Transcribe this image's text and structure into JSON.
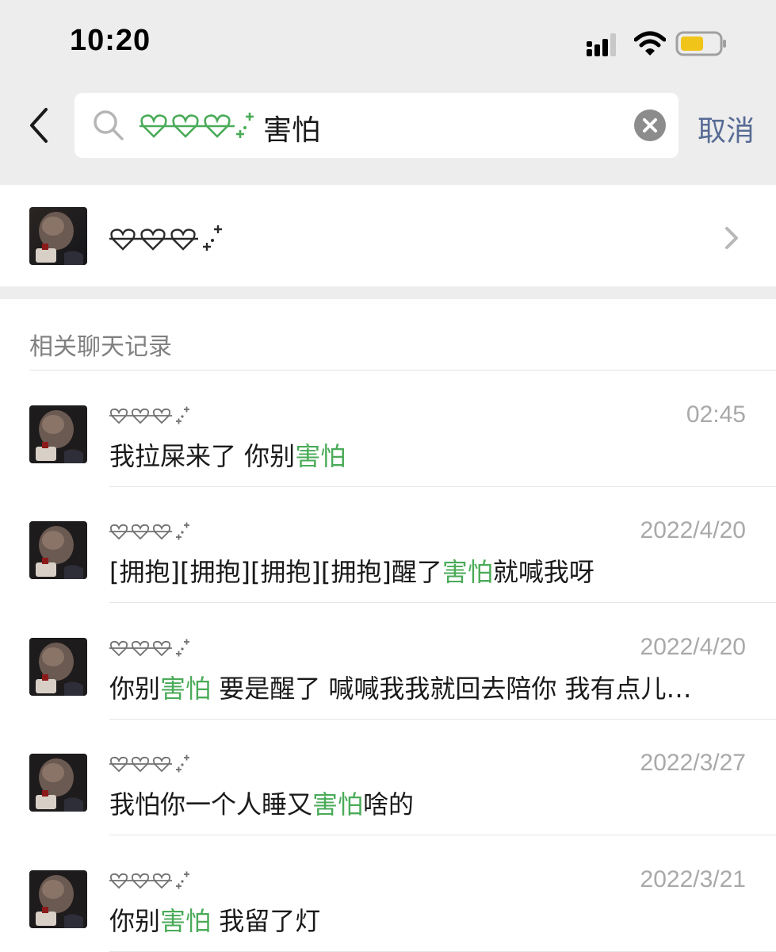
{
  "status_bar": {
    "time": "10:20"
  },
  "search": {
    "query_text": "害怕",
    "cancel_label": "取消"
  },
  "contact": {
    "name_icon": "strikethrough-hearts-sparkle"
  },
  "section": {
    "title": "相关聊天记录"
  },
  "results": [
    {
      "date": "02:45",
      "before": "我拉屎来了 你别",
      "highlight": "害怕",
      "after": ""
    },
    {
      "date": "2022/4/20",
      "before": "[拥抱][拥抱][拥抱][拥抱]醒了",
      "highlight": "害怕",
      "after": "就喊我呀"
    },
    {
      "date": "2022/4/20",
      "before": "你别",
      "highlight": "害怕",
      "after": " 要是醒了  喊喊我我就回去陪你 我有点儿…"
    },
    {
      "date": "2022/3/27",
      "before": "我怕你一个人睡又",
      "highlight": "害怕",
      "after": "啥的"
    },
    {
      "date": "2022/3/21",
      "before": "你别",
      "highlight": "害怕",
      "after": " 我留了灯"
    }
  ],
  "colors": {
    "highlight": "#4aab58",
    "cancel": "#576b95",
    "background": "#ededed"
  }
}
